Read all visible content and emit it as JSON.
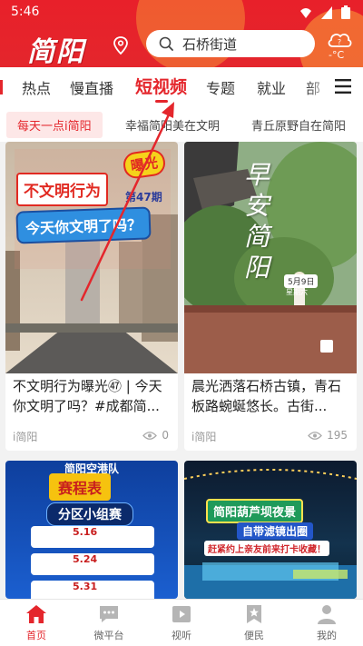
{
  "status_bar": {
    "time": "5:46"
  },
  "header": {
    "app_name": "简阳",
    "search_text": "石桥街道",
    "weather_temp": "-°C"
  },
  "tabs": [
    {
      "label": "热点"
    },
    {
      "label": "慢直播"
    },
    {
      "label": "短视频"
    },
    {
      "label": "专题"
    },
    {
      "label": "就业"
    },
    {
      "label": "部"
    }
  ],
  "active_tab": "短视频",
  "subtabs": [
    {
      "label": "每天一点i简阳"
    },
    {
      "label": "幸福简阳美在文明"
    },
    {
      "label": "青丘原野自在简阳"
    }
  ],
  "cards": [
    {
      "title": "不文明行为曝光㊼ | 今天你文明了吗？#成都简...",
      "source": "i简阳",
      "views": "0",
      "thumb_texts": {
        "headline": "不文明行为",
        "badge": "曝光",
        "issue": "第47期",
        "question": "今天你文明了吗？"
      }
    },
    {
      "title": "晨光洒落石桥古镇，青石板路蜿蜒悠长。古街...",
      "source": "i简阳",
      "views": "195",
      "thumb_texts": {
        "calligraphy": "早安简阳",
        "date": "5月9日",
        "weekday": "星期六"
      }
    },
    {
      "title": "",
      "source": "",
      "views": "",
      "thumb_texts": {
        "top": "简阳空港队",
        "banner": "赛程表",
        "group": "分区小组赛",
        "d1": "5.16",
        "d2": "5.24",
        "d3": "5.31"
      }
    },
    {
      "title": "",
      "source": "",
      "views": "",
      "thumb_texts": {
        "title": "简阳葫芦坝夜景",
        "subtitle": "自带滤镜出圈",
        "cta": "赶紧约上亲友前来打卡收藏！"
      }
    }
  ],
  "bottom_nav": [
    {
      "label": "首页",
      "icon": "home-icon"
    },
    {
      "label": "微平台",
      "icon": "chat-icon"
    },
    {
      "label": "视听",
      "icon": "play-icon"
    },
    {
      "label": "便民",
      "icon": "bookmark-star-icon"
    },
    {
      "label": "我的",
      "icon": "user-icon"
    }
  ],
  "colors": {
    "brand_red": "#e4262c",
    "active_subtab_bg": "#fde7e7"
  }
}
